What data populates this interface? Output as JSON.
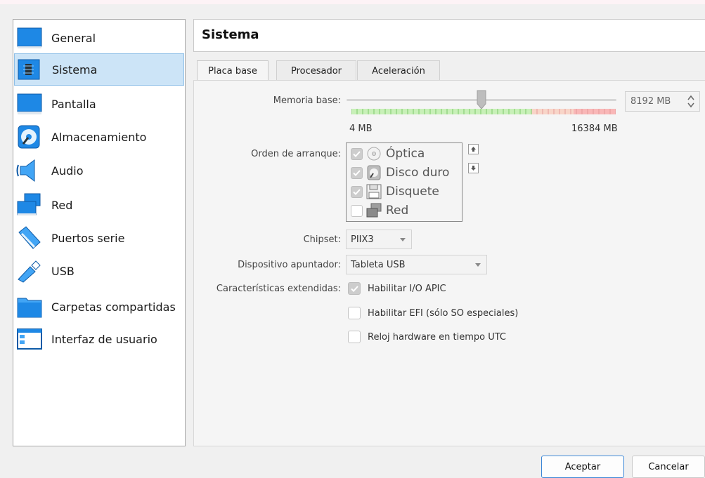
{
  "sidebar": {
    "items": [
      {
        "label": "General",
        "icon": "general-icon"
      },
      {
        "label": "Sistema",
        "icon": "system-icon",
        "selected": true
      },
      {
        "label": "Pantalla",
        "icon": "display-icon"
      },
      {
        "label": "Almacenamiento",
        "icon": "storage-icon"
      },
      {
        "label": "Audio",
        "icon": "audio-icon"
      },
      {
        "label": "Red",
        "icon": "network-icon"
      },
      {
        "label": "Puertos serie",
        "icon": "serial-port-icon"
      },
      {
        "label": "USB",
        "icon": "usb-icon"
      },
      {
        "label": "Carpetas compartidas",
        "icon": "shared-folder-icon"
      },
      {
        "label": "Interfaz de usuario",
        "icon": "user-interface-icon"
      }
    ]
  },
  "header": {
    "title": "Sistema"
  },
  "tabs": [
    {
      "label": "Placa base",
      "active": true
    },
    {
      "label": "Procesador"
    },
    {
      "label": "Aceleración"
    }
  ],
  "motherboard": {
    "memory_label": "Memoria base:",
    "memory_value": "8192 MB",
    "memory_fraction": 0.5,
    "memory_min": "4 MB",
    "memory_max": "16384 MB",
    "boot_label": "Orden de arranque:",
    "boot_items": [
      {
        "label": "Óptica",
        "checked": true,
        "icon": "optical-disc-icon"
      },
      {
        "label": "Disco duro",
        "checked": true,
        "icon": "hard-disk-icon"
      },
      {
        "label": "Disquete",
        "checked": true,
        "icon": "floppy-icon"
      },
      {
        "label": "Red",
        "checked": false,
        "icon": "network-icon"
      }
    ],
    "chipset_label": "Chipset:",
    "chipset_value": "PIIX3",
    "pointing_label": "Dispositivo apuntador:",
    "pointing_value": "Tableta USB",
    "extended_label": "Características extendidas:",
    "extended_options": [
      {
        "label": "Habilitar I/O APIC",
        "checked": true
      },
      {
        "label": "Habilitar EFI (sólo SO especiales)",
        "checked": false
      },
      {
        "label": "Reloj hardware en tiempo UTC",
        "checked": false
      }
    ]
  },
  "buttons": {
    "ok": "Aceptar",
    "cancel": "Cancelar"
  },
  "colors": {
    "selection": "#cce4f7",
    "accent": "#3a86d6",
    "scale_green": "#9fe08a",
    "scale_red": "#f4a3a3"
  }
}
